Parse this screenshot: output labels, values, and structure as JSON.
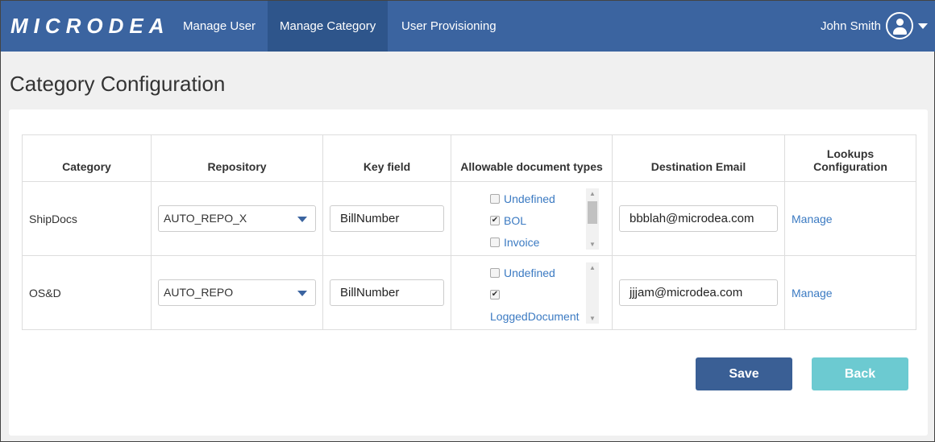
{
  "nav": {
    "logo": "MICRODEA",
    "items": [
      "Manage User",
      "Manage Category",
      "User Provisioning"
    ],
    "user": "John Smith"
  },
  "page": {
    "title": "Category Configuration"
  },
  "table": {
    "headers": [
      "Category",
      "Repository",
      "Key field",
      "Allowable document types",
      "Destination Email",
      "Lookups Configuration"
    ],
    "rows": [
      {
        "category": "ShipDocs",
        "repository": "AUTO_REPO_X",
        "key_field": "BillNumber",
        "doc_types": [
          {
            "label": "Undefined",
            "checked": false
          },
          {
            "label": "BOL",
            "checked": true
          },
          {
            "label": "Invoice",
            "checked": false
          }
        ],
        "email": "bbblah@microdea.com",
        "lookup": "Manage"
      },
      {
        "category": "OS&D",
        "repository": "AUTO_REPO",
        "key_field": "BillNumber",
        "doc_types": [
          {
            "label": "Undefined",
            "checked": false
          },
          {
            "label": "LoggedDocument",
            "checked": true
          }
        ],
        "email": "jjjam@microdea.com",
        "lookup": "Manage"
      }
    ]
  },
  "buttons": {
    "save": "Save",
    "back": "Back"
  }
}
